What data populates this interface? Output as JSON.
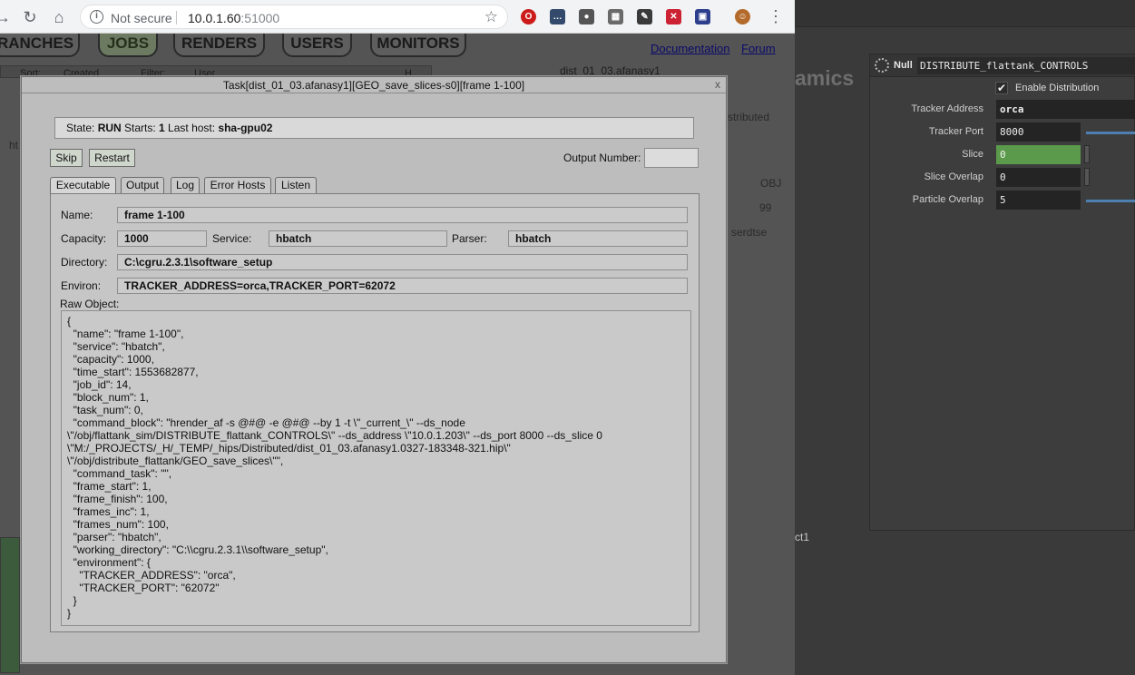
{
  "browser": {
    "security_label": "Not secure",
    "url_host": "10.0.1.60",
    "url_port": ":51000",
    "extensions": [
      {
        "icon": "opera-icon",
        "color": "#cc1b1b"
      },
      {
        "icon": "terminal-icon",
        "color": "#334a6c"
      },
      {
        "icon": "balls-icon",
        "color": "#555555"
      },
      {
        "icon": "dice-icon",
        "color": "#6a6a6a"
      },
      {
        "icon": "pen-icon",
        "color": "#3a3a3a"
      },
      {
        "icon": "crop-icon",
        "color": "#cc2233"
      },
      {
        "icon": "frame-icon",
        "color": "#2c3e8c"
      },
      {
        "icon": "avatar-icon",
        "color": "#b46a2a"
      }
    ]
  },
  "web": {
    "nav": [
      "RANCHES",
      "JOBS",
      "RENDERS",
      "USERS",
      "MONITORS"
    ],
    "active_nav": "JOBS",
    "links": {
      "documentation": "Documentation",
      "forum": "Forum"
    },
    "bg_job_title": "dist_01_03.afanasy1",
    "bg_sort": "Sort:",
    "bg_created": "Created",
    "bg_filter": "Filter:",
    "bg_user": "User",
    "bg_h": "H",
    "bg_distributed": "stributed",
    "bg_obj": "OBJ",
    "bg_99": "99",
    "bg_serdtse": "serdtse",
    "bg_ht": "ht"
  },
  "dialog": {
    "title": "Task[dist_01_03.afanasy1][GEO_save_slices-s0][frame 1-100]",
    "close": "x",
    "state": {
      "state_label": "State: ",
      "state_value": "RUN",
      "starts_label": " Starts: ",
      "starts_value": "1",
      "host_label": " Last host: ",
      "host_value": "sha-gpu02"
    },
    "buttons": {
      "skip": "Skip",
      "restart": "Restart"
    },
    "output_number_label": "Output Number:",
    "output_number_value": "",
    "tabs": [
      "Executable",
      "Output",
      "Log",
      "Error Hosts",
      "Listen"
    ],
    "fields": {
      "name_label": "Name:",
      "name_value": "frame 1-100",
      "capacity_label": "Capacity:",
      "capacity_value": "1000",
      "service_label": "Service:",
      "service_value": "hbatch",
      "parser_label": "Parser:",
      "parser_value": "hbatch",
      "directory_label": "Directory:",
      "directory_value": "C:\\cgru.2.3.1\\software_setup",
      "environ_label": "Environ:",
      "environ_value": "TRACKER_ADDRESS=orca,TRACKER_PORT=62072",
      "raw_label": "Raw Object:"
    },
    "raw_object": "{\n  \"name\": \"frame 1-100\",\n  \"service\": \"hbatch\",\n  \"capacity\": 1000,\n  \"time_start\": 1553682877,\n  \"job_id\": 14,\n  \"block_num\": 1,\n  \"task_num\": 0,\n  \"command_block\": \"hrender_af -s @#@ -e @#@ --by 1 -t \\\"_current_\\\" --ds_node\n\\\"/obj/flattank_sim/DISTRIBUTE_flattank_CONTROLS\\\" --ds_address \\\"10.0.1.203\\\" --ds_port 8000 --ds_slice 0\n\\\"M:/_PROJECTS/_H/_TEMP/_hips/Distributed/dist_01_03.afanasy1.0327-183348-321.hip\\\"\n\\\"/obj/distribute_flattank/GEO_save_slices\\\"\",\n  \"command_task\": \"\",\n  \"frame_start\": 1,\n  \"frame_finish\": 100,\n  \"frames_inc\": 1,\n  \"frames_num\": 100,\n  \"parser\": \"hbatch\",\n  \"working_directory\": \"C:\\\\cgru.2.3.1\\\\software_setup\",\n  \"environment\": {\n    \"TRACKER_ADDRESS\": \"orca\",\n    \"TRACKER_PORT\": \"62072\"\n  }\n}"
  },
  "houdini": {
    "bg_text": "amics",
    "node_type": "Null",
    "node_name": "DISTRIBUTE_flattank_CONTROLS",
    "enable_label": "Enable Distribution",
    "params": [
      {
        "label": "Tracker Address",
        "value": "orca"
      },
      {
        "label": "Tracker Port",
        "value": "8000"
      },
      {
        "label": "Slice",
        "value": "0"
      },
      {
        "label": "Slice Overlap",
        "value": "0"
      },
      {
        "label": "Particle Overlap",
        "value": "5"
      }
    ],
    "bottom_text": "ct1"
  }
}
